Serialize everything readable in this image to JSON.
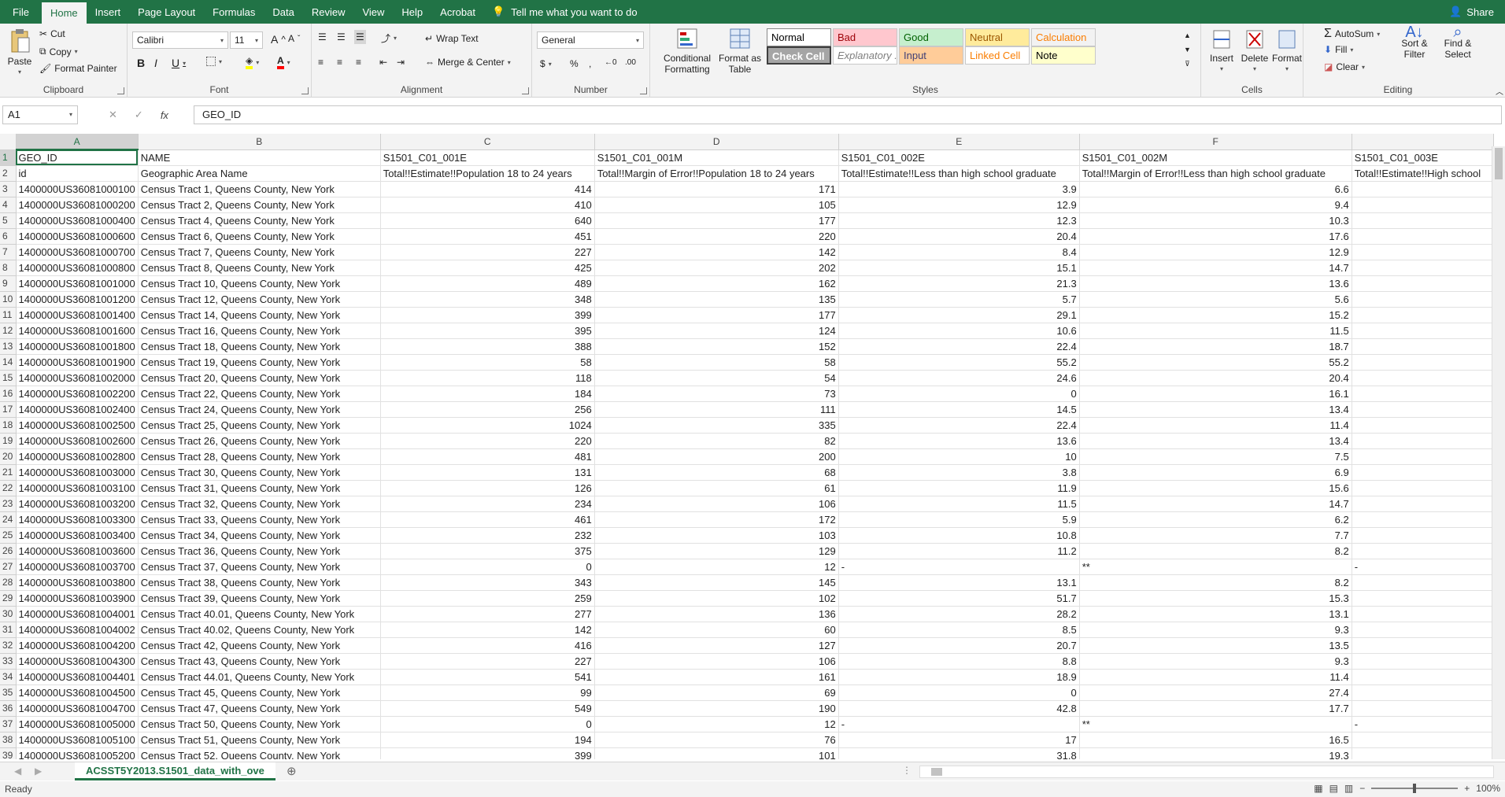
{
  "ribbon_tabs": [
    "File",
    "Home",
    "Insert",
    "Page Layout",
    "Formulas",
    "Data",
    "Review",
    "View",
    "Help",
    "Acrobat"
  ],
  "tell_me": "Tell me what you want to do",
  "share": "Share",
  "clipboard": {
    "paste": "Paste",
    "cut": "Cut",
    "copy": "Copy",
    "format_painter": "Format Painter",
    "label": "Clipboard"
  },
  "font": {
    "name": "Calibri",
    "size": "11",
    "label": "Font"
  },
  "alignment": {
    "wrap": "Wrap Text",
    "merge": "Merge & Center",
    "label": "Alignment"
  },
  "number": {
    "format": "General",
    "label": "Number"
  },
  "styles": {
    "conditional": "Conditional Formatting",
    "format_table": "Format as Table",
    "label": "Styles",
    "cells": [
      {
        "label": "Normal",
        "bg": "#ffffff",
        "fg": "#000000"
      },
      {
        "label": "Bad",
        "bg": "#ffc7ce",
        "fg": "#9c0006"
      },
      {
        "label": "Good",
        "bg": "#c6efce",
        "fg": "#006100"
      },
      {
        "label": "Neutral",
        "bg": "#ffeb9c",
        "fg": "#9c5700"
      },
      {
        "label": "Calculation",
        "bg": "#f2f2f2",
        "fg": "#fa7d00"
      },
      {
        "label": "Check Cell",
        "bg": "#a5a5a5",
        "fg": "#ffffff"
      },
      {
        "label": "Explanatory ...",
        "bg": "#ffffff",
        "fg": "#7f7f7f"
      },
      {
        "label": "Input",
        "bg": "#ffcc99",
        "fg": "#3f3f76"
      },
      {
        "label": "Linked Cell",
        "bg": "#ffffff",
        "fg": "#fa7d00"
      },
      {
        "label": "Note",
        "bg": "#ffffcc",
        "fg": "#000000"
      }
    ]
  },
  "cells_group": {
    "insert": "Insert",
    "delete": "Delete",
    "format": "Format",
    "label": "Cells"
  },
  "editing": {
    "autosum": "AutoSum",
    "fill": "Fill",
    "clear": "Clear",
    "sort": "Sort & Filter",
    "find": "Find & Select",
    "label": "Editing"
  },
  "formula_bar": {
    "cell_ref": "A1",
    "fx": "fx",
    "content": "GEO_ID"
  },
  "columns": [
    "A",
    "B",
    "C",
    "D",
    "E",
    "F"
  ],
  "rows": [
    [
      "GEO_ID",
      "NAME",
      "S1501_C01_001E",
      "S1501_C01_001M",
      "S1501_C01_002E",
      "S1501_C01_002M",
      "S1501_C01_003E"
    ],
    [
      "id",
      "Geographic Area Name",
      "Total!!Estimate!!Population 18 to 24 years",
      "Total!!Margin of Error!!Population 18 to 24 years",
      "Total!!Estimate!!Less than high school graduate",
      "Total!!Margin of Error!!Less than high school graduate",
      "Total!!Estimate!!High school"
    ],
    [
      "1400000US36081000100",
      "Census Tract 1, Queens County, New York",
      "414",
      "171",
      "3.9",
      "6.6",
      ""
    ],
    [
      "1400000US36081000200",
      "Census Tract 2, Queens County, New York",
      "410",
      "105",
      "12.9",
      "9.4",
      ""
    ],
    [
      "1400000US36081000400",
      "Census Tract 4, Queens County, New York",
      "640",
      "177",
      "12.3",
      "10.3",
      ""
    ],
    [
      "1400000US36081000600",
      "Census Tract 6, Queens County, New York",
      "451",
      "220",
      "20.4",
      "17.6",
      ""
    ],
    [
      "1400000US36081000700",
      "Census Tract 7, Queens County, New York",
      "227",
      "142",
      "8.4",
      "12.9",
      ""
    ],
    [
      "1400000US36081000800",
      "Census Tract 8, Queens County, New York",
      "425",
      "202",
      "15.1",
      "14.7",
      ""
    ],
    [
      "1400000US36081001000",
      "Census Tract 10, Queens County, New York",
      "489",
      "162",
      "21.3",
      "13.6",
      ""
    ],
    [
      "1400000US36081001200",
      "Census Tract 12, Queens County, New York",
      "348",
      "135",
      "5.7",
      "5.6",
      ""
    ],
    [
      "1400000US36081001400",
      "Census Tract 14, Queens County, New York",
      "399",
      "177",
      "29.1",
      "15.2",
      ""
    ],
    [
      "1400000US36081001600",
      "Census Tract 16, Queens County, New York",
      "395",
      "124",
      "10.6",
      "11.5",
      ""
    ],
    [
      "1400000US36081001800",
      "Census Tract 18, Queens County, New York",
      "388",
      "152",
      "22.4",
      "18.7",
      ""
    ],
    [
      "1400000US36081001900",
      "Census Tract 19, Queens County, New York",
      "58",
      "58",
      "55.2",
      "55.2",
      ""
    ],
    [
      "1400000US36081002000",
      "Census Tract 20, Queens County, New York",
      "118",
      "54",
      "24.6",
      "20.4",
      ""
    ],
    [
      "1400000US36081002200",
      "Census Tract 22, Queens County, New York",
      "184",
      "73",
      "0",
      "16.1",
      ""
    ],
    [
      "1400000US36081002400",
      "Census Tract 24, Queens County, New York",
      "256",
      "111",
      "14.5",
      "13.4",
      ""
    ],
    [
      "1400000US36081002500",
      "Census Tract 25, Queens County, New York",
      "1024",
      "335",
      "22.4",
      "11.4",
      ""
    ],
    [
      "1400000US36081002600",
      "Census Tract 26, Queens County, New York",
      "220",
      "82",
      "13.6",
      "13.4",
      ""
    ],
    [
      "1400000US36081002800",
      "Census Tract 28, Queens County, New York",
      "481",
      "200",
      "10",
      "7.5",
      ""
    ],
    [
      "1400000US36081003000",
      "Census Tract 30, Queens County, New York",
      "131",
      "68",
      "3.8",
      "6.9",
      ""
    ],
    [
      "1400000US36081003100",
      "Census Tract 31, Queens County, New York",
      "126",
      "61",
      "11.9",
      "15.6",
      ""
    ],
    [
      "1400000US36081003200",
      "Census Tract 32, Queens County, New York",
      "234",
      "106",
      "11.5",
      "14.7",
      ""
    ],
    [
      "1400000US36081003300",
      "Census Tract 33, Queens County, New York",
      "461",
      "172",
      "5.9",
      "6.2",
      ""
    ],
    [
      "1400000US36081003400",
      "Census Tract 34, Queens County, New York",
      "232",
      "103",
      "10.8",
      "7.7",
      ""
    ],
    [
      "1400000US36081003600",
      "Census Tract 36, Queens County, New York",
      "375",
      "129",
      "11.2",
      "8.2",
      ""
    ],
    [
      "1400000US36081003700",
      "Census Tract 37, Queens County, New York",
      "0",
      "12",
      "-",
      "**",
      "-"
    ],
    [
      "1400000US36081003800",
      "Census Tract 38, Queens County, New York",
      "343",
      "145",
      "13.1",
      "8.2",
      ""
    ],
    [
      "1400000US36081003900",
      "Census Tract 39, Queens County, New York",
      "259",
      "102",
      "51.7",
      "15.3",
      ""
    ],
    [
      "1400000US36081004001",
      "Census Tract 40.01, Queens County, New York",
      "277",
      "136",
      "28.2",
      "13.1",
      ""
    ],
    [
      "1400000US36081004002",
      "Census Tract 40.02, Queens County, New York",
      "142",
      "60",
      "8.5",
      "9.3",
      ""
    ],
    [
      "1400000US36081004200",
      "Census Tract 42, Queens County, New York",
      "416",
      "127",
      "20.7",
      "13.5",
      ""
    ],
    [
      "1400000US36081004300",
      "Census Tract 43, Queens County, New York",
      "227",
      "106",
      "8.8",
      "9.3",
      ""
    ],
    [
      "1400000US36081004401",
      "Census Tract 44.01, Queens County, New York",
      "541",
      "161",
      "18.9",
      "11.4",
      ""
    ],
    [
      "1400000US36081004500",
      "Census Tract 45, Queens County, New York",
      "99",
      "69",
      "0",
      "27.4",
      ""
    ],
    [
      "1400000US36081004700",
      "Census Tract 47, Queens County, New York",
      "549",
      "190",
      "42.8",
      "17.7",
      ""
    ],
    [
      "1400000US36081005000",
      "Census Tract 50, Queens County, New York",
      "0",
      "12",
      "-",
      "**",
      "-"
    ],
    [
      "1400000US36081005100",
      "Census Tract 51, Queens County, New York",
      "194",
      "76",
      "17",
      "16.5",
      ""
    ],
    [
      "1400000US36081005200",
      "Census Tract 52, Queens County, New York",
      "399",
      "101",
      "31.8",
      "19.3",
      ""
    ]
  ],
  "sheet_tab": "ACSST5Y2013.S1501_data_with_ove",
  "status": "Ready",
  "zoom": "100%"
}
